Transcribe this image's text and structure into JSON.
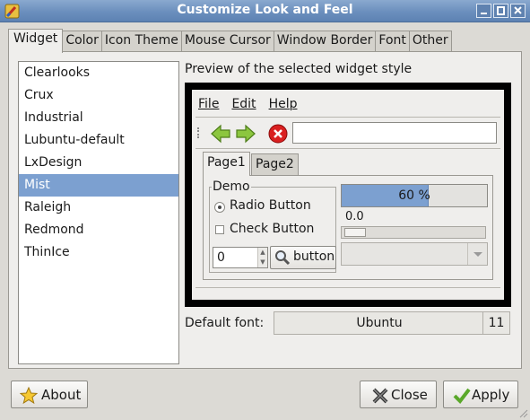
{
  "window": {
    "title": "Customize Look and Feel"
  },
  "tabs": [
    "Widget",
    "Color",
    "Icon Theme",
    "Mouse Cursor",
    "Window Border",
    "Font",
    "Other"
  ],
  "themes": [
    "Clearlooks",
    "Crux",
    "Industrial",
    "Lubuntu-default",
    "LxDesign",
    "Mist",
    "Raleigh",
    "Redmond",
    "ThinIce"
  ],
  "selected_theme": "Mist",
  "preview": {
    "label": "Preview of the selected widget style",
    "menu": [
      "File",
      "Edit",
      "Help"
    ],
    "entry_value": "",
    "pages": [
      "Page1",
      "Page2"
    ],
    "demo_label": "Demo",
    "radio_label": "Radio Button",
    "check_label": "Check Button",
    "spin_value": "0",
    "button_label": "button",
    "progress_text": "60 %",
    "progress_fraction": 0.6,
    "scale_value": "0.0"
  },
  "font": {
    "label": "Default font:",
    "name": "Ubuntu",
    "size": "11"
  },
  "buttons": {
    "about": "About",
    "close": "Close",
    "apply": "Apply"
  },
  "colors": {
    "accent": "#7ca0d0",
    "titlebar": "#6b8fbd"
  }
}
